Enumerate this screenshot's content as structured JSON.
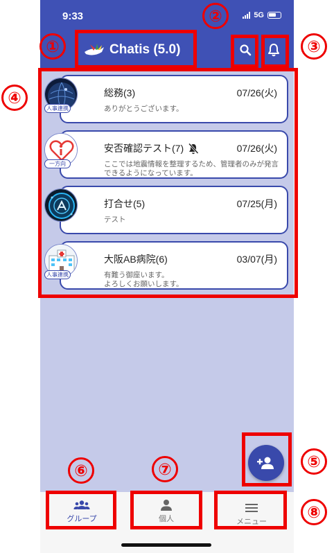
{
  "status_bar": {
    "time": "9:33",
    "network": "5G"
  },
  "app_bar": {
    "title": "Chatis (5.0)"
  },
  "chats": [
    {
      "name": "総務(3)",
      "date": "07/26(火)",
      "message": "ありがとうございます。",
      "tag": "人事連携",
      "muted": false,
      "avatar": "globe-avatar"
    },
    {
      "name": "安否確認テスト(7)",
      "date": "07/26(火)",
      "message": "ここでは地震情報を整理するため、管理者のみが発言\nできるようになっています。",
      "tag": "一方向",
      "muted": true,
      "avatar": "heart-info-avatar"
    },
    {
      "name": "打合せ(5)",
      "date": "07/25(月)",
      "message": "テスト",
      "tag": "",
      "muted": false,
      "avatar": "tech-avatar"
    },
    {
      "name": "大阪AB病院(6)",
      "date": "03/07(月)",
      "message": "有難う御座います。\nよろしくお願いします。",
      "tag": "人事連携",
      "muted": false,
      "avatar": "hospital-avatar"
    }
  ],
  "bottom_nav": {
    "group": "グループ",
    "personal": "個人",
    "menu": "メニュー"
  },
  "annotations": [
    "①",
    "②",
    "③",
    "④",
    "⑤",
    "⑥",
    "⑦",
    "⑧"
  ],
  "colors": {
    "primary": "#3f51b5",
    "background": "#c5cae9",
    "annotation": "#ee0000"
  }
}
